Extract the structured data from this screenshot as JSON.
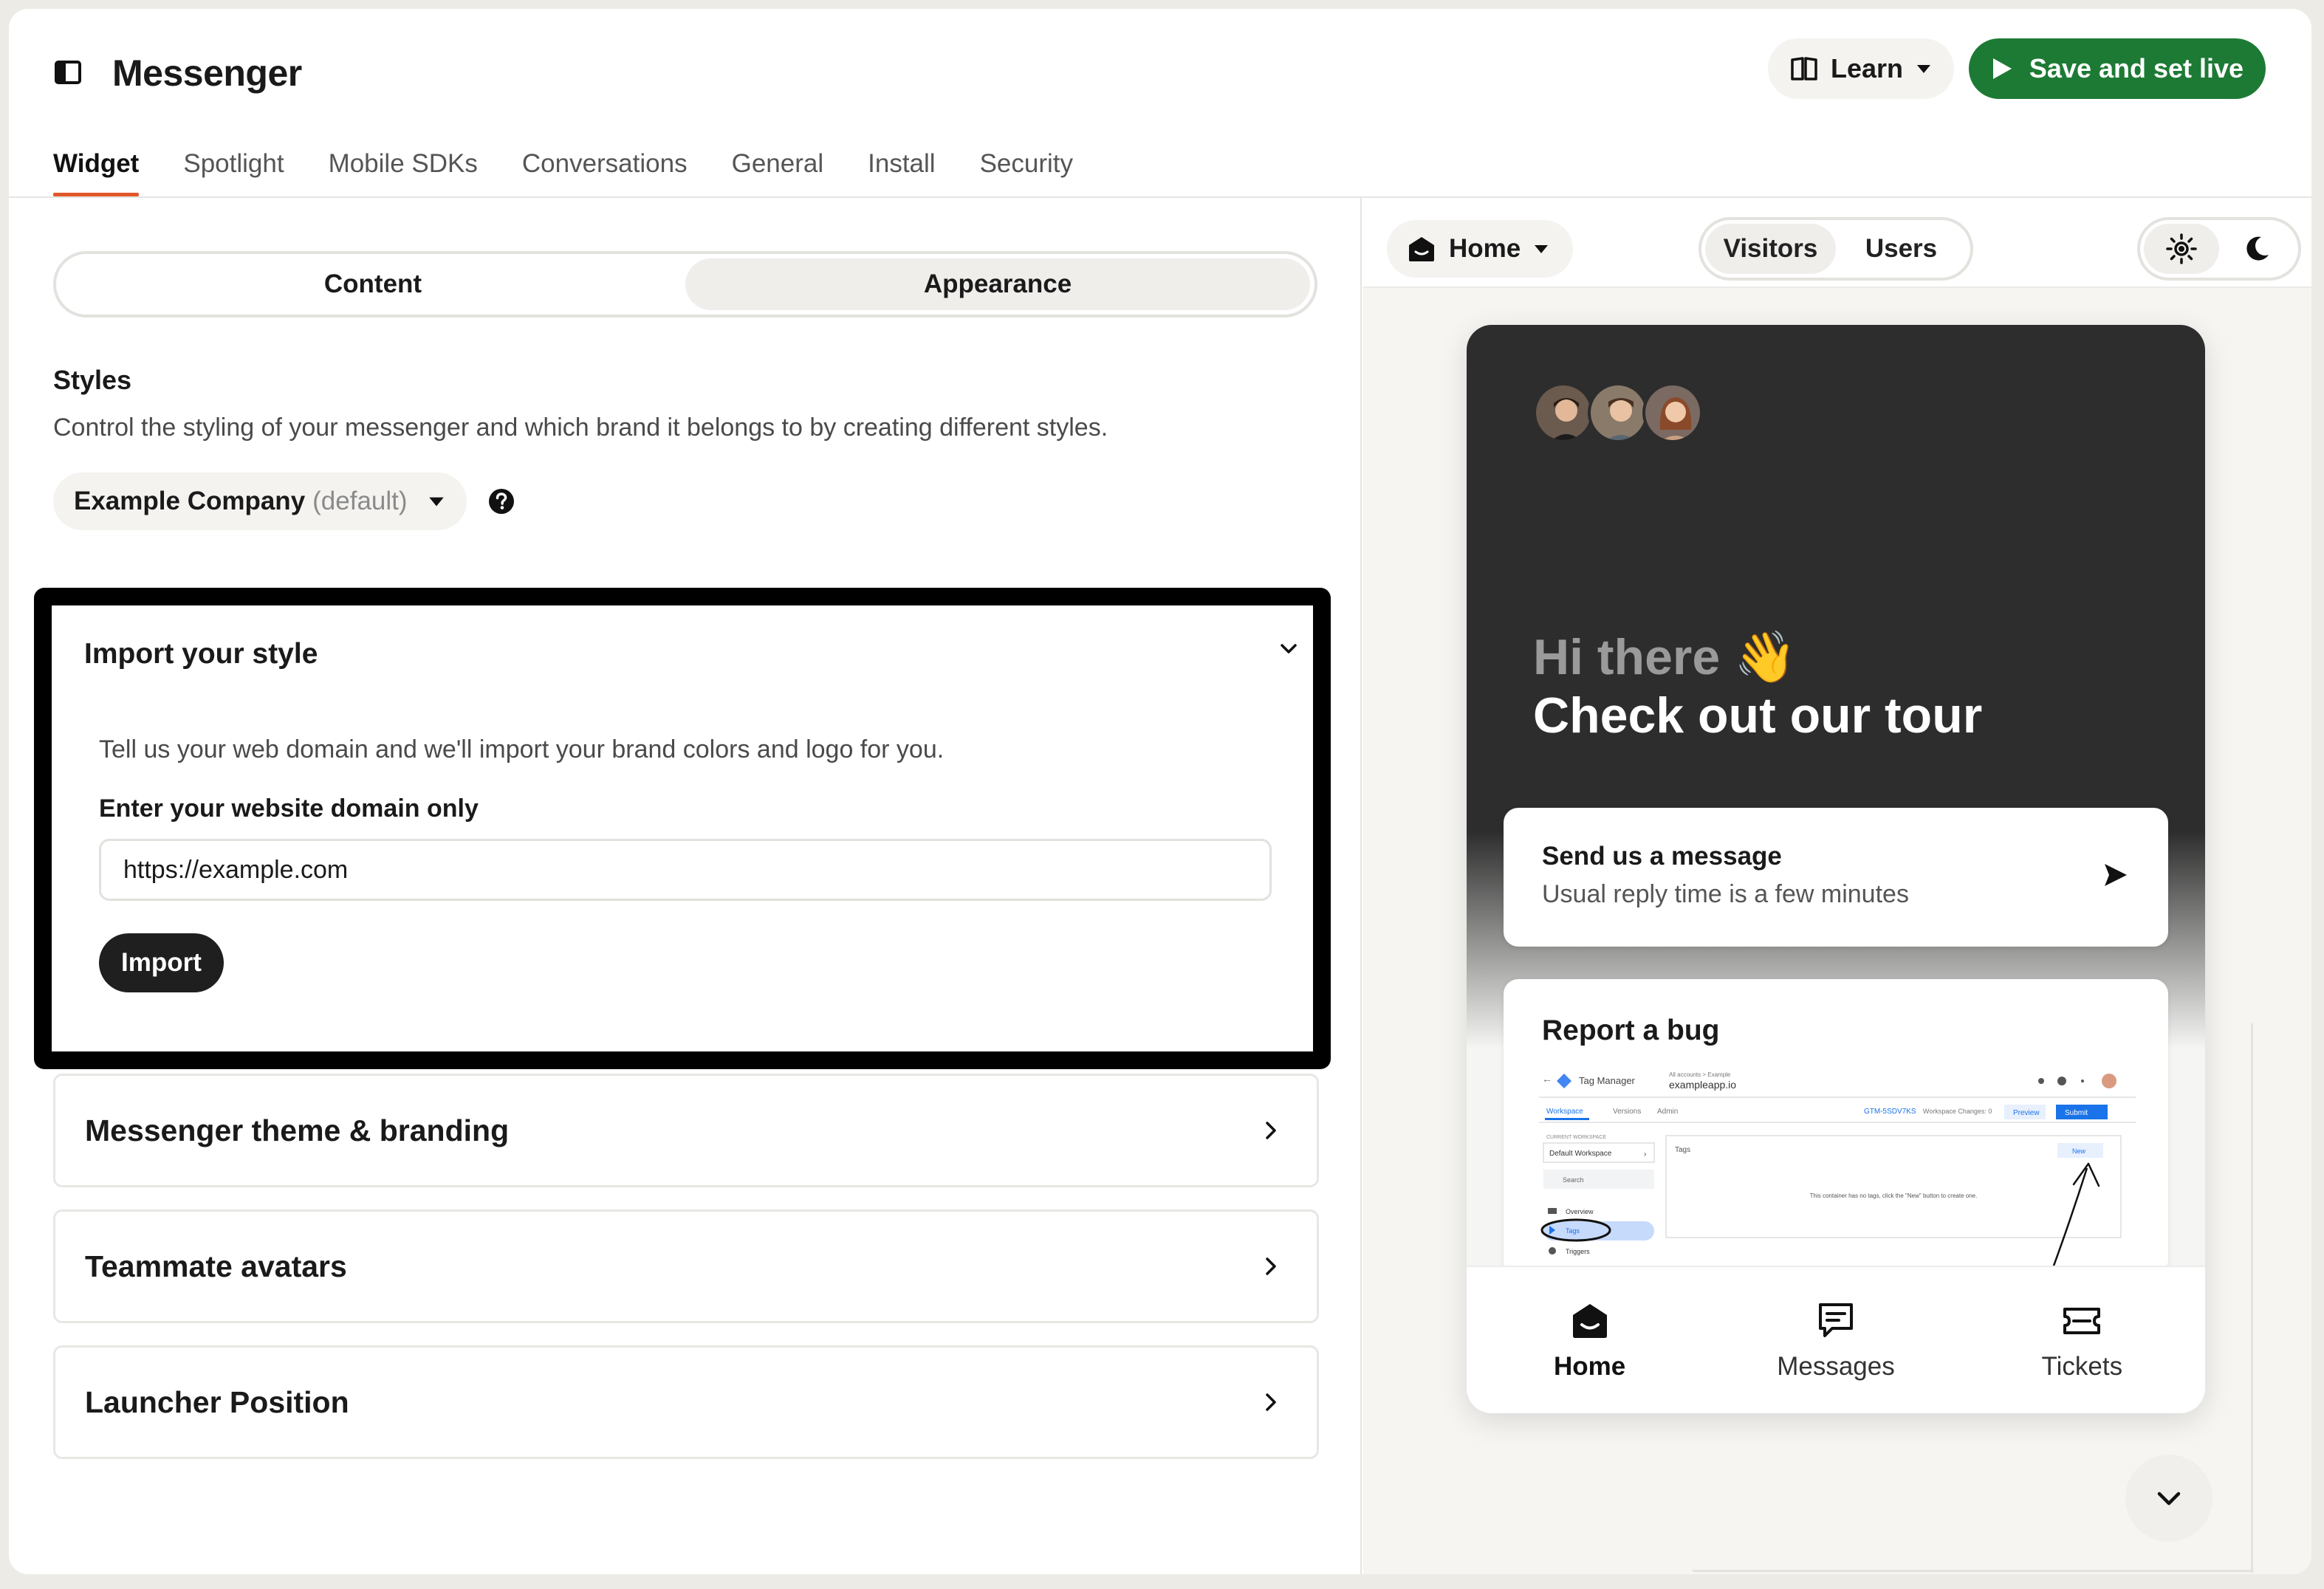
{
  "header": {
    "title": "Messenger",
    "learn_label": "Learn",
    "save_label": "Save and set live",
    "accent_color": "#1d7a34"
  },
  "tabs": [
    "Widget",
    "Spotlight",
    "Mobile SDKs",
    "Conversations",
    "General",
    "Install",
    "Security"
  ],
  "active_tab": "Widget",
  "segment": {
    "options": [
      "Content",
      "Appearance"
    ],
    "selected": "Appearance"
  },
  "styles": {
    "heading": "Styles",
    "description": "Control the styling of your messenger and which brand it belongs to by creating different styles.",
    "company_name": "Example Company",
    "company_suffix": "(default)"
  },
  "import_section": {
    "title": "Import your style",
    "description": "Tell us your web domain and we'll import your brand colors and logo for you.",
    "field_label": "Enter your website domain only",
    "field_value": "https://example.com",
    "button_label": "Import"
  },
  "accordions": [
    "Messenger theme & branding",
    "Teammate avatars",
    "Launcher Position"
  ],
  "preview": {
    "page_select": "Home",
    "audience_options": [
      "Visitors",
      "Users"
    ],
    "audience_selected": "Visitors",
    "greeting_line1": "Hi there 👋",
    "greeting_line2": "Check out our tour",
    "message_card": {
      "title": "Send us a message",
      "subtitle": "Usual reply time is a few minutes"
    },
    "bug_card": {
      "title": "Report a bug",
      "screenshot": {
        "app_name": "Tag Manager",
        "breadcrumb": "All accounts > Example",
        "domain": "exampleapp.io",
        "tabs": [
          "Workspace",
          "Versions",
          "Admin"
        ],
        "container_id": "GTM-5SDV7KS",
        "changes": "Workspace Changes: 0",
        "preview": "Preview",
        "submit": "Submit",
        "current_ws": "CURRENT WORKSPACE",
        "ws_name": "Default Workspace",
        "search": "Search",
        "nav": [
          "Overview",
          "Tags",
          "Triggers"
        ],
        "panel_title": "Tags",
        "new_label": "New",
        "empty_msg": "This container has no tags, click the \"New\" button to create one."
      }
    },
    "nav": [
      {
        "label": "Home",
        "icon": "home-icon"
      },
      {
        "label": "Messages",
        "icon": "messages-icon"
      },
      {
        "label": "Tickets",
        "icon": "ticket-icon"
      }
    ]
  }
}
